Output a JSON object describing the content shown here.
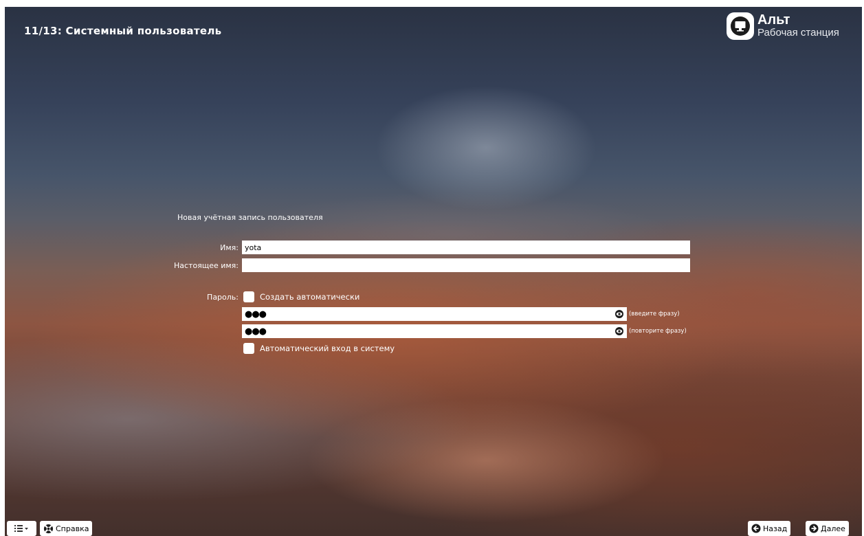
{
  "header": {
    "step_title": "11/13: Системный пользователь"
  },
  "logo": {
    "name": "Альт",
    "subtitle": "Рабочая станция",
    "icon": "monitor-icon"
  },
  "form": {
    "section_title": "Новая учётная запись пользователя",
    "name_label": "Имя:",
    "name_value": "yota",
    "realname_label": "Настоящее имя:",
    "realname_value": "",
    "password_label": "Пароль:",
    "auto_password_label": "Создать автоматически",
    "auto_password_checked": false,
    "password1_mask": "●●●",
    "password1_hint": "(введите фразу)",
    "password2_mask": "●●●",
    "password2_hint": "(повторите фразу)",
    "autologin_label": "Автоматический вход в систему",
    "autologin_checked": false
  },
  "footer": {
    "menu_icon": "list-menu-icon",
    "help_label": "Справка",
    "back_label": "Назад",
    "next_label": "Далее"
  },
  "colors": {
    "text": "#ffffff",
    "field_bg": "#ffffff"
  }
}
